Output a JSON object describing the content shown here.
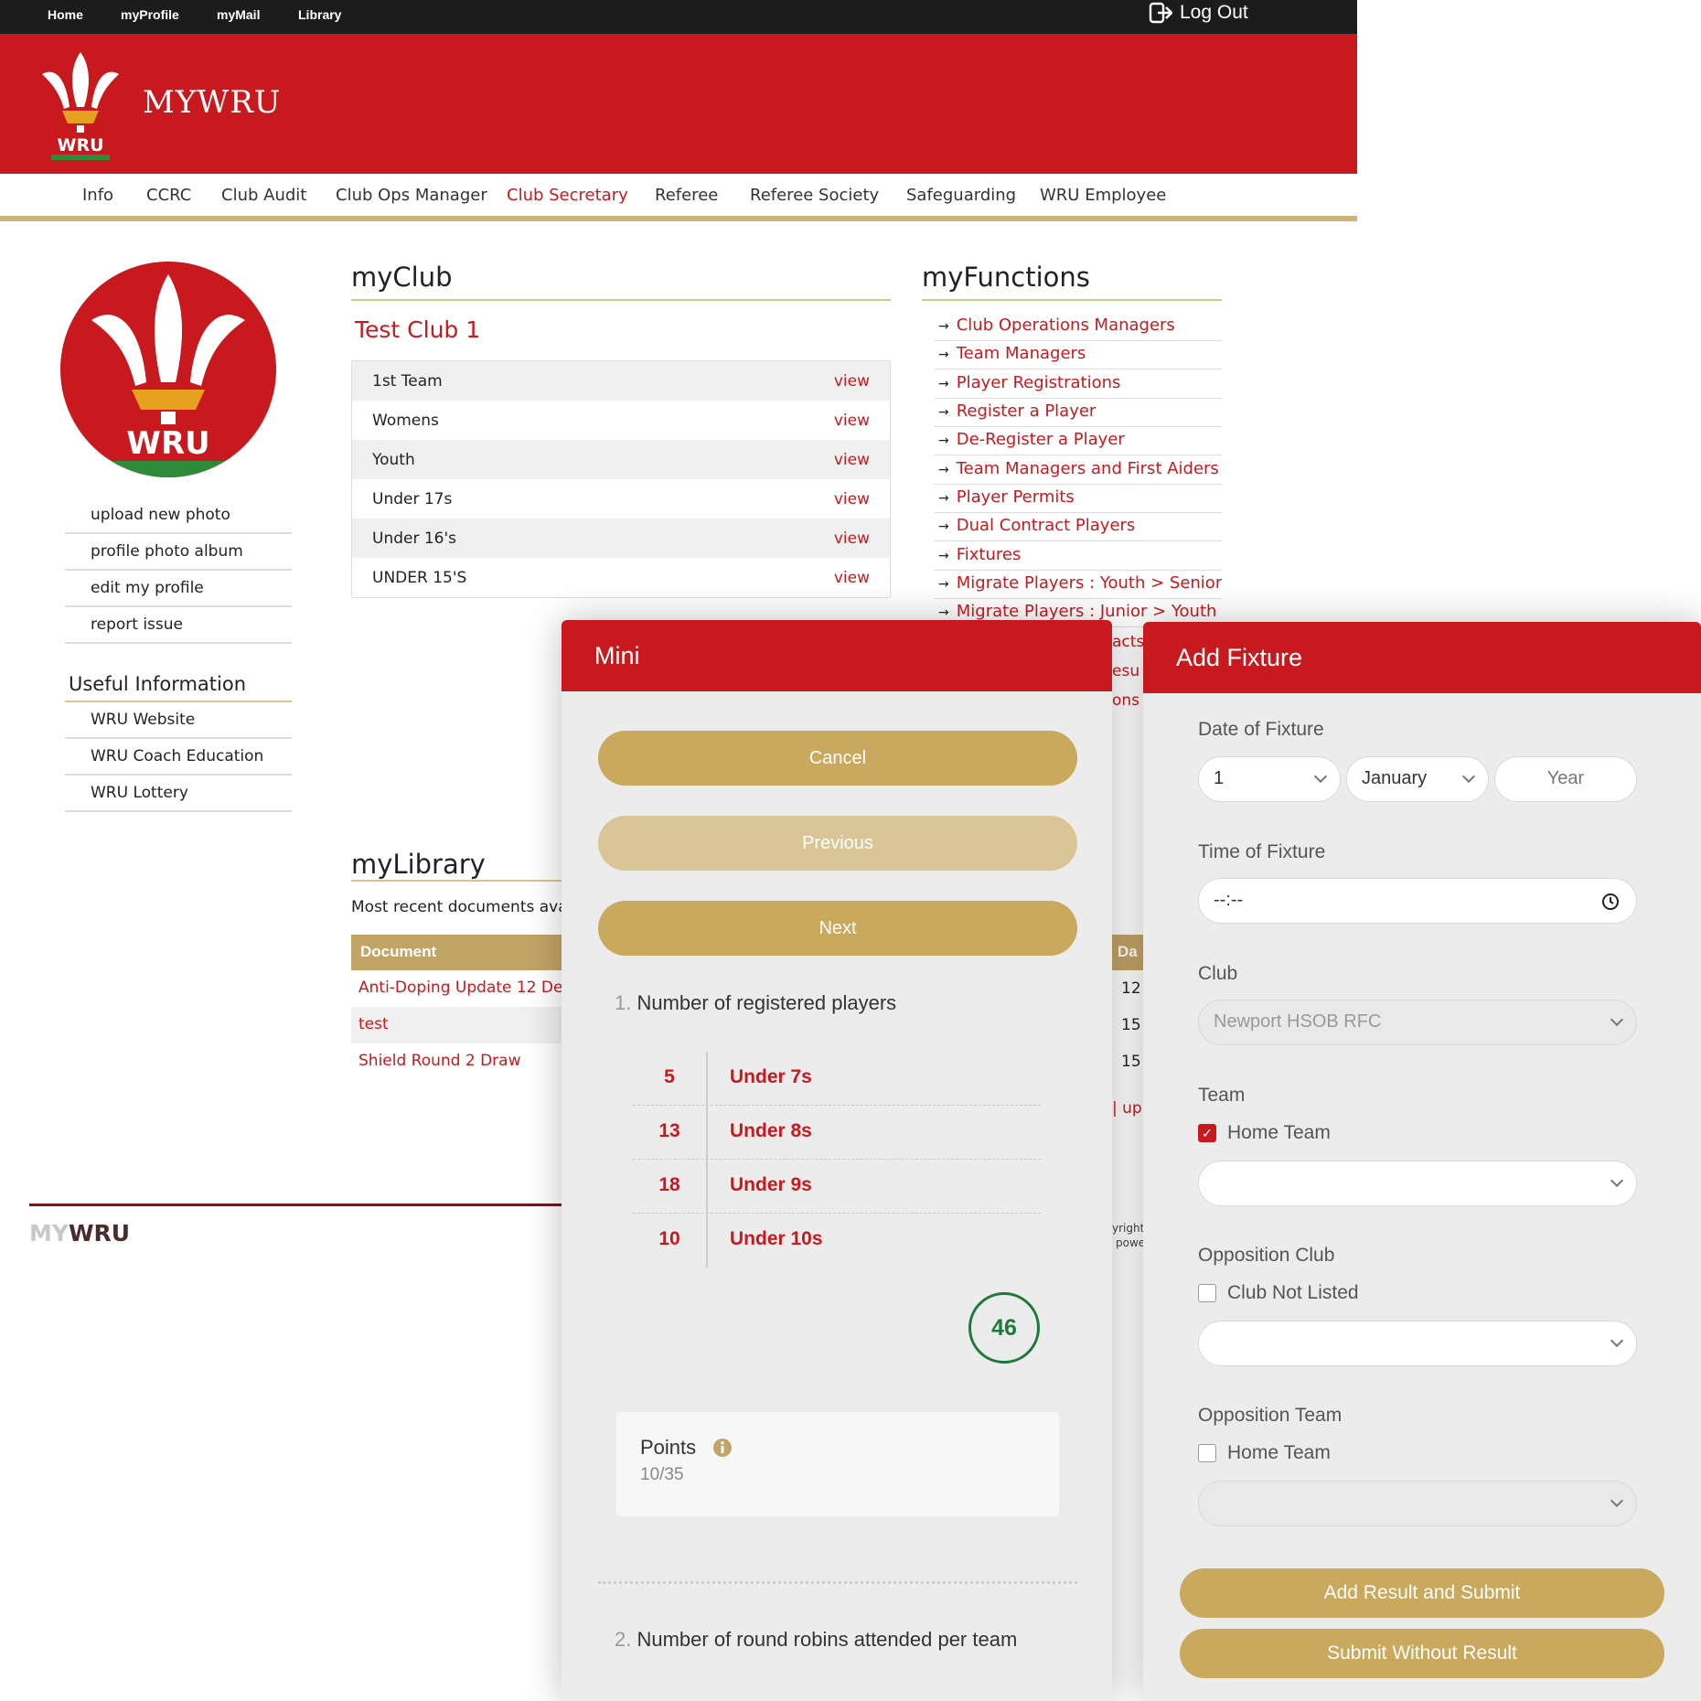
{
  "topnav": {
    "items": [
      "Home",
      "myProfile",
      "myMail",
      "Library"
    ],
    "logout": "Log Out"
  },
  "header": {
    "brand_my": "MY",
    "brand_wru": "WRU",
    "logo_text": "WRU"
  },
  "mainnav": {
    "items": [
      "Info",
      "CCRC",
      "Club Audit",
      "Club Ops Manager",
      "Club Secretary",
      "Referee",
      "Referee Society",
      "Safeguarding",
      "WRU Employee"
    ],
    "active": "Club Secretary"
  },
  "sidebar": {
    "links": [
      "upload new photo",
      "profile photo album",
      "edit my profile",
      "report issue"
    ],
    "useful_title": "Useful Information",
    "useful_links": [
      "WRU Website",
      "WRU Coach Education",
      "WRU Lottery"
    ]
  },
  "myclub": {
    "title": "myClub",
    "club_name": "Test Club 1",
    "teams": [
      {
        "name": "1st Team",
        "action": "view"
      },
      {
        "name": "Womens",
        "action": "view"
      },
      {
        "name": "Youth",
        "action": "view"
      },
      {
        "name": "Under 17s",
        "action": "view"
      },
      {
        "name": "Under 16's",
        "action": "view"
      },
      {
        "name": "UNDER 15'S",
        "action": "view"
      }
    ]
  },
  "myfunctions": {
    "title": "myFunctions",
    "items": [
      "Club Operations Managers",
      "Team Managers",
      "Player Registrations",
      "Register a Player",
      "De-Register a Player",
      "Team Managers and First Aiders",
      "Player Permits",
      "Dual Contract Players",
      "Fixtures",
      "Migrate Players : Youth > Senior",
      "Migrate Players : Junior > Youth"
    ],
    "peek_fragments": [
      "acts",
      "esu",
      "ons"
    ]
  },
  "mylibrary": {
    "title": "myLibrary",
    "subtitle": "Most recent documents avail",
    "column": "Document",
    "date_column_fragment": "Da",
    "documents": [
      "Anti-Doping Update 12 Dec",
      "test",
      "Shield Round 2 Draw"
    ],
    "date_fragments": [
      "12",
      "15",
      "15"
    ],
    "link_fragment": "| up"
  },
  "footer": {
    "brand_my": "MY",
    "brand_wru": "WRU",
    "fragment_1": "yright",
    "fragment_2": "powe"
  },
  "mini_modal": {
    "title": "Mini",
    "cancel": "Cancel",
    "previous": "Previous",
    "next": "Next",
    "q1_num": "1.",
    "q1_text": "Number of registered players",
    "players": [
      {
        "count": "5",
        "group": "Under 7s"
      },
      {
        "count": "13",
        "group": "Under 8s"
      },
      {
        "count": "18",
        "group": "Under 9s"
      },
      {
        "count": "10",
        "group": "Under 10s"
      }
    ],
    "total": "46",
    "points_label": "Points",
    "points_value": "10/35",
    "q2_num": "2.",
    "q2_text": "Number of round robins attended per team"
  },
  "fixture_modal": {
    "title": "Add Fixture",
    "date_label": "Date of Fixture",
    "day": "1",
    "month": "January",
    "year_placeholder": "Year",
    "time_label": "Time of Fixture",
    "time_placeholder": "--:--",
    "club_label": "Club",
    "club_value": "Newport HSOB RFC",
    "team_label": "Team",
    "home_team_checkbox": "Home Team",
    "opposition_club_label": "Opposition Club",
    "club_not_listed": "Club Not Listed",
    "opposition_team_label": "Opposition Team",
    "opp_home_team_checkbox": "Home Team",
    "add_result": "Add Result and Submit",
    "submit_without": "Submit Without Result"
  },
  "colors": {
    "brand_red": "#c8191e",
    "gold": "#c9a95e",
    "gold_light": "#dac596",
    "total_green": "#1d7a3a"
  }
}
